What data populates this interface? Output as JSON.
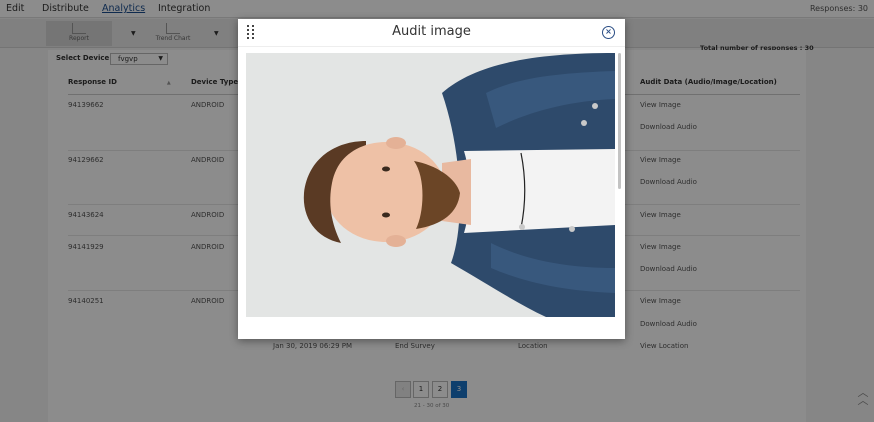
{
  "nav": {
    "items": [
      "Edit",
      "Distribute",
      "Analytics",
      "Integration"
    ],
    "responses": "Responses: 30"
  },
  "toolbar": {
    "buttons": [
      "Report",
      "Trend Chart"
    ],
    "total": "Total number of responses : 30"
  },
  "device": {
    "label": "Select Device",
    "value": "fvgvp"
  },
  "table": {
    "headers": [
      "Response ID",
      "Device Type",
      "Audit Data (Audio/Image/Location)"
    ],
    "rows": [
      {
        "id": "94139662",
        "device": "ANDROID",
        "links": [
          "View Image",
          "Download Audio"
        ]
      },
      {
        "id": "94129662",
        "device": "ANDROID",
        "links": [
          "View Image",
          "Download Audio"
        ]
      },
      {
        "id": "94143624",
        "device": "ANDROID",
        "links": [
          "View Image"
        ]
      },
      {
        "id": "94141929",
        "device": "ANDROID",
        "links": [
          "View Image",
          "Download Audio"
        ]
      },
      {
        "id": "94140251",
        "device": "ANDROID",
        "links": [
          "View Image",
          "Download Audio",
          "View Location"
        ]
      }
    ],
    "last_row_extra": {
      "date": "Jan 30, 2019 06:29 PM",
      "status": "End Survey",
      "type": "Location"
    }
  },
  "pagination": {
    "pages": [
      "‹",
      "1",
      "2",
      "3"
    ],
    "active": "3",
    "info": "21 - 30 of 30"
  },
  "modal": {
    "title": "Audit image",
    "close": "×"
  },
  "colors": {
    "accent": "#1a73c6",
    "close": "#2a4d84"
  }
}
